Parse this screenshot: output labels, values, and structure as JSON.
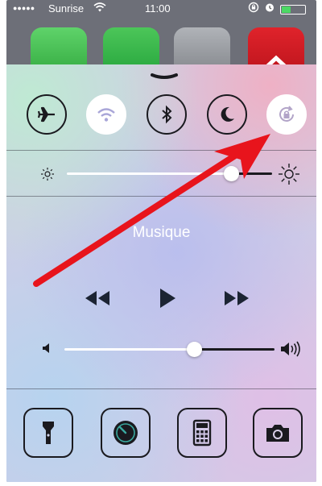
{
  "statusbar": {
    "carrier": "Sunrise",
    "time": "11:00",
    "signal_dots": "●●●●●",
    "battery_level": 0.4
  },
  "home_icons": [
    "messages-app-icon",
    "whatsapp-app-icon",
    "settings-app-icon",
    "sbb-app-icon"
  ],
  "control_center": {
    "toggles": [
      {
        "name": "airplane-mode",
        "icon": "airplane-icon",
        "on": false
      },
      {
        "name": "wifi",
        "icon": "wifi-icon",
        "on": true
      },
      {
        "name": "bluetooth",
        "icon": "bluetooth-icon",
        "on": false
      },
      {
        "name": "do-not-disturb",
        "icon": "moon-icon",
        "on": false
      },
      {
        "name": "rotation-lock",
        "icon": "rotation-lock-icon",
        "on": true
      }
    ],
    "brightness": 0.8,
    "music": {
      "title": "Musique",
      "volume": 0.62
    },
    "tools": [
      {
        "name": "flashlight",
        "icon": "flashlight-icon"
      },
      {
        "name": "timer",
        "icon": "timer-icon"
      },
      {
        "name": "calculator",
        "icon": "calculator-icon"
      },
      {
        "name": "camera",
        "icon": "camera-icon"
      }
    ]
  },
  "colors": {
    "accent_arrow": "#e8141c",
    "dark": "#1a1a1f",
    "track_filled": "#ffffff"
  }
}
